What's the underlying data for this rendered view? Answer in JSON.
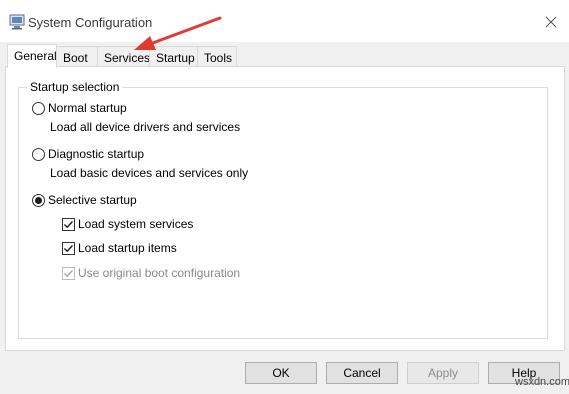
{
  "window": {
    "title": "System Configuration",
    "app_icon": "msconfig-icon",
    "close_icon": "close-icon"
  },
  "tabs": [
    {
      "label": "General",
      "active": true
    },
    {
      "label": "Boot",
      "active": false
    },
    {
      "label": "Services",
      "active": false
    },
    {
      "label": "Startup",
      "active": false
    },
    {
      "label": "Tools",
      "active": false
    }
  ],
  "startup_selection": {
    "group_label": "Startup selection",
    "normal": {
      "label": "Normal startup",
      "description": "Load all device drivers and services",
      "selected": false
    },
    "diagnostic": {
      "label": "Diagnostic startup",
      "description": "Load basic devices and services only",
      "selected": false
    },
    "selective": {
      "label": "Selective startup",
      "selected": true
    },
    "options": [
      {
        "label": "Load system services",
        "checked": true,
        "enabled": true
      },
      {
        "label": "Load startup items",
        "checked": true,
        "enabled": true
      },
      {
        "label": "Use original boot configuration",
        "checked": true,
        "enabled": false
      }
    ]
  },
  "buttons": {
    "ok": "OK",
    "cancel": "Cancel",
    "apply": "Apply",
    "help": "Help"
  },
  "annotation": {
    "arrow_color": "#e03a32",
    "target": "Services"
  },
  "watermark": "wsxdn.com"
}
